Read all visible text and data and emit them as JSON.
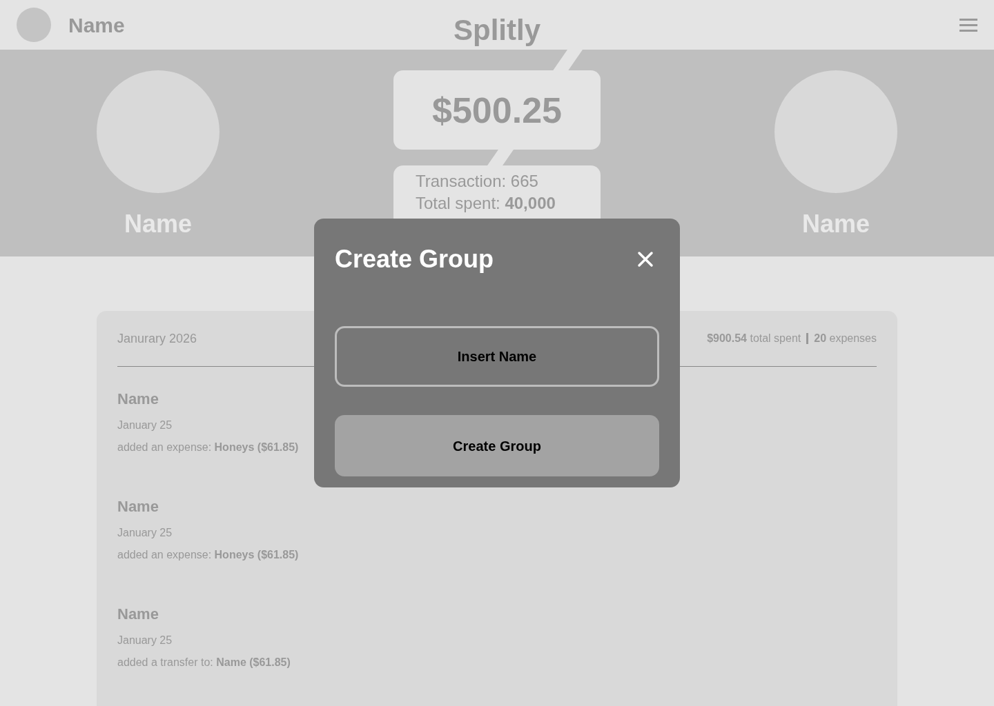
{
  "header": {
    "user_name": "Name",
    "app_title": "Splitly"
  },
  "hero": {
    "left_name": "Name",
    "right_name": "Name",
    "balance": "$500.25",
    "stats": [
      "Transaction: 665",
      "Total spent: **40,000**"
    ]
  },
  "activity": {
    "month": "Janurary 2026",
    "total": "**$900.54** total spent",
    "count": "**20** expenses",
    "items": [
      {
        "name": "Name",
        "date": "January 25",
        "text": "added an expense: **Honeys ($61.85)**"
      },
      {
        "name": "Name",
        "date": "January 25",
        "text": "added an expense: **Honeys ($61.85)**"
      },
      {
        "name": "Name",
        "date": "January 25",
        "text": "added a transfer to: **Name ($61.85)**"
      }
    ]
  },
  "modal": {
    "title": "Create Group",
    "placeholder": "Insert Name",
    "button": "Create Group"
  }
}
